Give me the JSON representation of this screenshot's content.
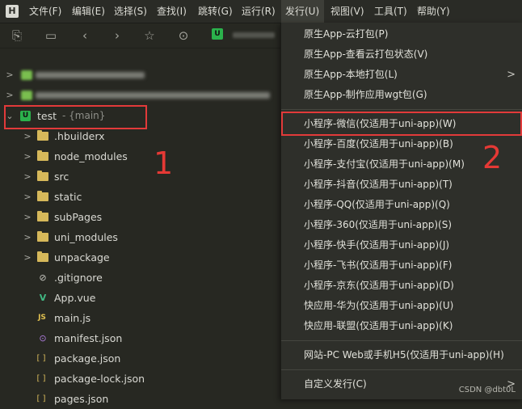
{
  "menubar": {
    "logo": "H",
    "items": [
      "文件(F)",
      "编辑(E)",
      "选择(S)",
      "查找(I)",
      "跳转(G)",
      "运行(R)",
      "发行(U)",
      "视图(V)",
      "工具(T)",
      "帮助(Y)"
    ]
  },
  "toolbar": {
    "project_chip": "U"
  },
  "explorer": {
    "project_icon": "U",
    "project_name": "test",
    "project_branch": "- {main}",
    "folders": [
      ".hbuilderx",
      "node_modules",
      "src",
      "static",
      "subPages",
      "uni_modules",
      "unpackage"
    ],
    "files": [
      {
        "icon": "⊘",
        "name": ".gitignore"
      },
      {
        "icon": "V",
        "name": "App.vue"
      },
      {
        "icon": "JS",
        "name": "main.js"
      },
      {
        "icon": "⊙",
        "name": "manifest.json"
      },
      {
        "icon": "[ ]",
        "name": "package.json"
      },
      {
        "icon": "[ ]",
        "name": "package-lock.json"
      },
      {
        "icon": "[ ]",
        "name": "pages.json"
      }
    ]
  },
  "annotations": {
    "one": "1",
    "two": "2",
    "color": "#e23a3a"
  },
  "dropdown": {
    "group1": [
      "原生App-云打包(P)",
      "原生App-查看云打包状态(V)",
      "原生App-本地打包(L)",
      "原生App-制作应用wgt包(G)"
    ],
    "group2": [
      "小程序-微信(仅适用于uni-app)(W)",
      "小程序-百度(仅适用于uni-app)(B)",
      "小程序-支付宝(仅适用于uni-app)(M)",
      "小程序-抖音(仅适用于uni-app)(T)",
      "小程序-QQ(仅适用于uni-app)(Q)",
      "小程序-360(仅适用于uni-app)(S)",
      "小程序-快手(仅适用于uni-app)(J)",
      "小程序-飞书(仅适用于uni-app)(F)",
      "小程序-京东(仅适用于uni-app)(D)",
      "快应用-华为(仅适用于uni-app)(U)",
      "快应用-联盟(仅适用于uni-app)(K)"
    ],
    "web": "网站-PC Web或手机H5(仅适用于uni-app)(H)",
    "custom": "自定义发行(C)"
  },
  "watermark": "CSDN @dbt0L"
}
